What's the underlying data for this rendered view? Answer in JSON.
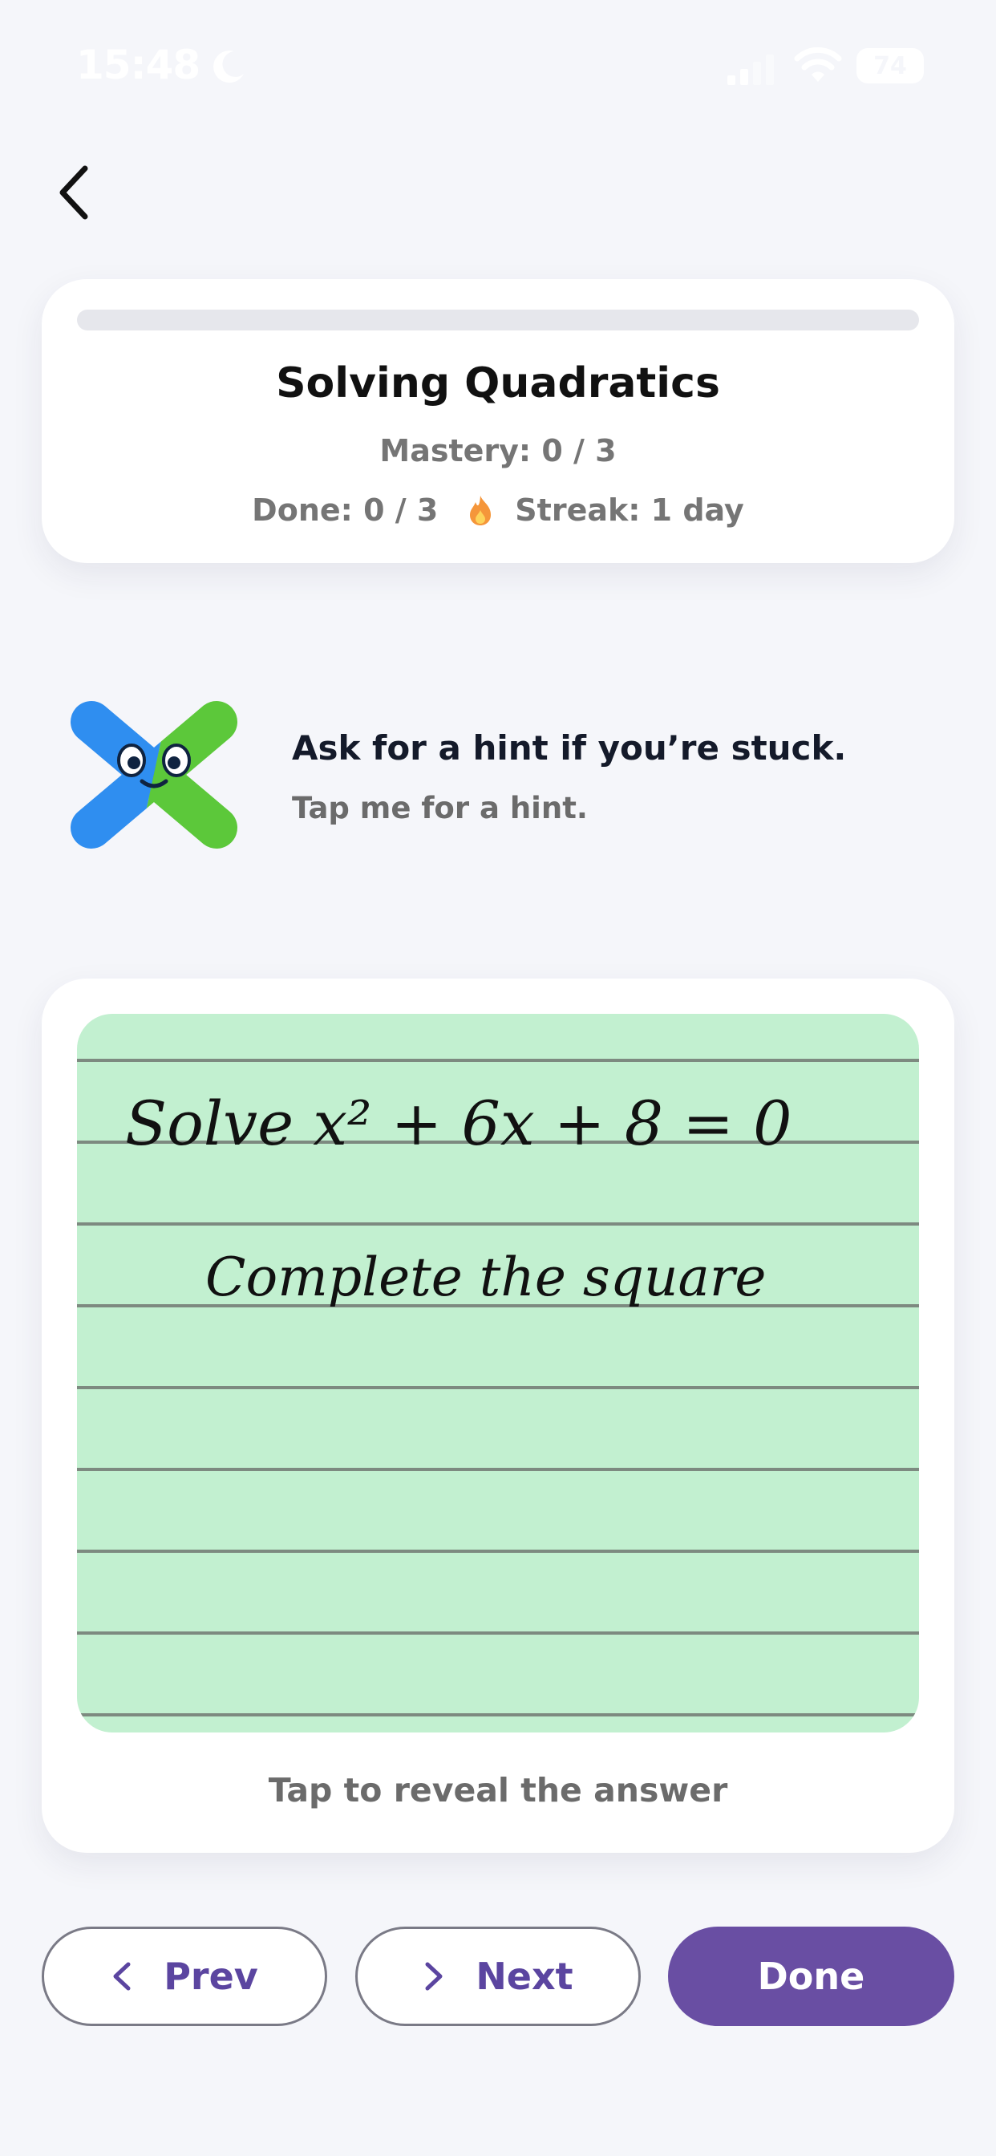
{
  "status_bar": {
    "time": "15:48",
    "battery": "74"
  },
  "topic": {
    "title": "Solving Quadratics",
    "mastery": "Mastery: 0 / 3",
    "done": "Done: 0 / 3",
    "streak": "Streak: 1 day",
    "progress_fraction": 0
  },
  "hint": {
    "title": "Ask for a hint if you’re stuck.",
    "subtitle": "Tap me for a hint."
  },
  "card": {
    "question_text": "Solve x² + 6x + 8 = 0",
    "hint_text": "Complete the square",
    "reveal_label": "Tap to reveal the answer"
  },
  "buttons": {
    "prev": "Prev",
    "next": "Next",
    "done": "Done"
  },
  "colors": {
    "accent": "#694ea3",
    "notepad": "#c2f0d0",
    "background": "#f5f6fa"
  }
}
